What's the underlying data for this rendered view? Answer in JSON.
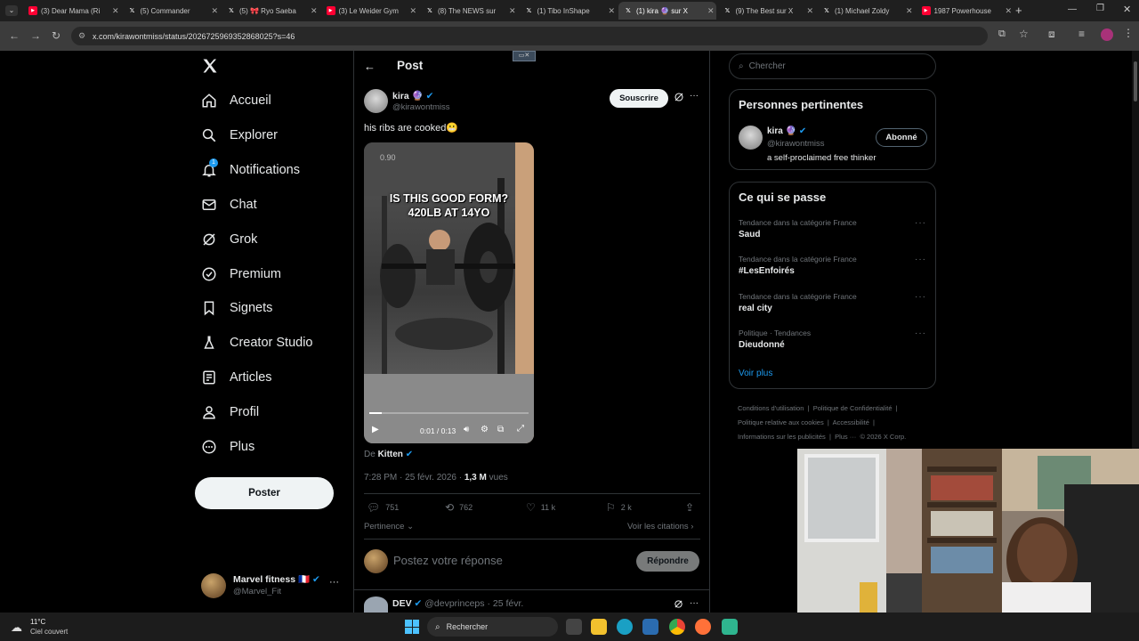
{
  "tabs": [
    {
      "title": "(3) Dear Mama (Ri",
      "icon": "youtube-icon",
      "color": "#ff0033"
    },
    {
      "title": "(5) Commander",
      "icon": "x-icon",
      "color": "#ffffff"
    },
    {
      "title": "(5) 🎀 Ryo Saeba",
      "icon": "x-icon",
      "color": "#ffffff"
    },
    {
      "title": "(3) Le Weider Gym",
      "icon": "youtube-icon",
      "color": "#ff0033"
    },
    {
      "title": "(8) The NEWS sur",
      "icon": "x-icon",
      "color": "#ffffff"
    },
    {
      "title": "(1) Tibo InShape",
      "icon": "x-icon",
      "color": "#ffffff"
    },
    {
      "title": "(1) kira 🔮 sur X",
      "icon": "x-icon",
      "color": "#ffffff",
      "active": true
    },
    {
      "title": "(9) The Best sur X",
      "icon": "x-icon",
      "color": "#ffffff"
    },
    {
      "title": "(1) Michael Zoldy",
      "icon": "x-icon",
      "color": "#ffffff"
    },
    {
      "title": "1987 Powerhouse",
      "icon": "youtube-icon",
      "color": "#ff0033"
    }
  ],
  "url": "x.com/kirawontmiss/status/2026725969352868025?s=46",
  "nav": {
    "items": [
      {
        "label": "Accueil",
        "icon": "home-icon"
      },
      {
        "label": "Explorer",
        "icon": "search-icon"
      },
      {
        "label": "Notifications",
        "icon": "bell-icon",
        "badge": "1"
      },
      {
        "label": "Chat",
        "icon": "mail-icon"
      },
      {
        "label": "Grok",
        "icon": "grok-icon"
      },
      {
        "label": "Premium",
        "icon": "verified-icon"
      },
      {
        "label": "Signets",
        "icon": "bookmark-icon"
      },
      {
        "label": "Creator Studio",
        "icon": "flask-icon"
      },
      {
        "label": "Articles",
        "icon": "article-icon"
      },
      {
        "label": "Profil",
        "icon": "person-icon"
      },
      {
        "label": "Plus",
        "icon": "more-circle-icon"
      }
    ],
    "post_button": "Poster",
    "account": {
      "name": "Marvel fitness 🇫🇷",
      "handle": "@Marvel_Fit"
    }
  },
  "post": {
    "header": "Post",
    "author_name": "kira 🔮",
    "author_handle": "@kirawontmiss",
    "subscribe": "Souscrire",
    "text": "his ribs are cooked😬",
    "video": {
      "caption_line1": "IS THIS GOOD FORM?",
      "caption_line2": "420LB AT 14YO",
      "speed": "0.90",
      "time": "0:01 / 0:13",
      "progress": 0.08
    },
    "source_prefix": "De",
    "source_name": "Kitten",
    "timestamp": "7:28 PM · 25 févr. 2026 ·",
    "views_count": "1,3 M",
    "views_label": "vues",
    "stats": {
      "replies": "751",
      "reposts": "762",
      "likes": "11 k",
      "bookmarks": "2 k"
    },
    "sort_label": "Pertinence",
    "quotes_label": "Voir les citations",
    "reply_placeholder": "Postez votre réponse",
    "reply_button": "Répondre",
    "next_reply": {
      "name": "DEV",
      "handle": "@devprinceps",
      "date": "· 25 févr."
    }
  },
  "sidebar": {
    "search_placeholder": "Chercher",
    "relevant": {
      "title": "Personnes pertinentes",
      "name": "kira 🔮",
      "handle": "@kirawontmiss",
      "bio": "a self-proclaimed free thinker",
      "button": "Abonné"
    },
    "trends": {
      "title": "Ce qui se passe",
      "items": [
        {
          "context": "Tendance dans la catégorie France",
          "name": "Saud"
        },
        {
          "context": "Tendance dans la catégorie France",
          "name": "#LesEnfoirés"
        },
        {
          "context": "Tendance dans la catégorie France",
          "name": "real city"
        },
        {
          "context": "Politique · Tendances",
          "name": "Dieudonné"
        }
      ],
      "more": "Voir plus"
    },
    "footer": {
      "terms": "Conditions d'utilisation",
      "privacy": "Politique de Confidentialité",
      "cookies": "Politique relative aux cookies",
      "accessibility": "Accessibilité",
      "ads": "Informations sur les publicités",
      "more": "Plus ···",
      "copyright": "© 2026 X Corp."
    }
  },
  "taskbar": {
    "temp": "11°C",
    "weather": "Ciel couvert",
    "search": "Rechercher"
  },
  "colors": {
    "accent": "#1d9bf0",
    "verified": "#1d9bf0",
    "bg": "#000000",
    "border": "#2f3336"
  }
}
